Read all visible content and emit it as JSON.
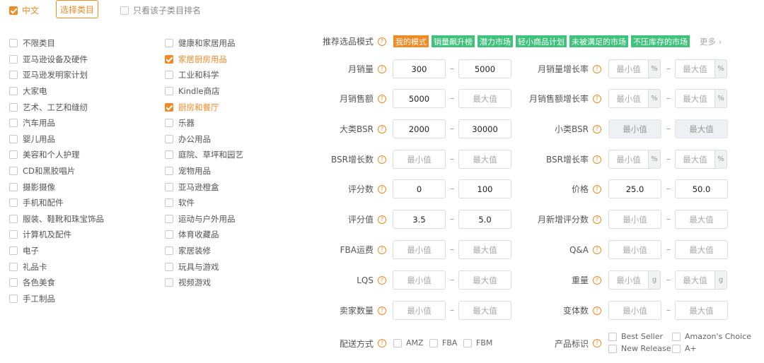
{
  "top": {
    "lang_label": "中文",
    "select_category_button": "选择类目",
    "only_subcategory_label": "只看该子类目排名"
  },
  "categories_left": [
    {
      "label": "不限类目",
      "checked": false
    },
    {
      "label": "亚马逊设备及硬件",
      "checked": false
    },
    {
      "label": "亚马逊发明家计划",
      "checked": false
    },
    {
      "label": "大家电",
      "checked": false
    },
    {
      "label": "艺术、工艺和缝纫",
      "checked": false
    },
    {
      "label": "汽车用品",
      "checked": false
    },
    {
      "label": "婴儿用品",
      "checked": false
    },
    {
      "label": "美容和个人护理",
      "checked": false
    },
    {
      "label": "CD和黑胶唱片",
      "checked": false
    },
    {
      "label": "摄影摄像",
      "checked": false
    },
    {
      "label": "手机和配件",
      "checked": false
    },
    {
      "label": "服装、鞋靴和珠宝饰品",
      "checked": false
    },
    {
      "label": "计算机及配件",
      "checked": false
    },
    {
      "label": "电子",
      "checked": false
    },
    {
      "label": "礼品卡",
      "checked": false
    },
    {
      "label": "各色美食",
      "checked": false
    },
    {
      "label": "手工制品",
      "checked": false
    }
  ],
  "categories_right": [
    {
      "label": "健康和家居用品",
      "checked": false
    },
    {
      "label": "家居厨房用品",
      "checked": true
    },
    {
      "label": "工业和科学",
      "checked": false
    },
    {
      "label": "Kindle商店",
      "checked": false
    },
    {
      "label": "厨房和餐厅",
      "checked": true
    },
    {
      "label": "乐器",
      "checked": false
    },
    {
      "label": "办公用品",
      "checked": false
    },
    {
      "label": "庭院、草坪和园艺",
      "checked": false
    },
    {
      "label": "宠物用品",
      "checked": false
    },
    {
      "label": "亚马逊橙盒",
      "checked": false
    },
    {
      "label": "软件",
      "checked": false
    },
    {
      "label": "运动与户外用品",
      "checked": false
    },
    {
      "label": "体育收藏品",
      "checked": false
    },
    {
      "label": "家居装修",
      "checked": false
    },
    {
      "label": "玩具与游戏",
      "checked": false
    },
    {
      "label": "视频游戏",
      "checked": false
    }
  ],
  "mode": {
    "label": "推荐选品模式",
    "tags": [
      "我的模式",
      "销量飙升榜",
      "潜力市场",
      "轻小商品计划",
      "未被满足的市场",
      "不压库存的市场"
    ],
    "more": "更多 ›"
  },
  "filters": {
    "monthly_sales": {
      "label": "月销量",
      "min": "300",
      "max": "5000"
    },
    "monthly_sales_growth": {
      "label": "月销量增长率",
      "min": "最小值",
      "max": "最大值",
      "unit": "%"
    },
    "monthly_revenue": {
      "label": "月销售额",
      "min": "5000",
      "max": "最大值"
    },
    "monthly_revenue_growth": {
      "label": "月销售额增长率",
      "min": "最小值",
      "max": "最大值",
      "unit": "%"
    },
    "main_bsr": {
      "label": "大类BSR",
      "min": "2000",
      "max": "30000"
    },
    "sub_bsr": {
      "label": "小类BSR",
      "min": "最小值",
      "max": "最大值"
    },
    "bsr_growth_count": {
      "label": "BSR增长数",
      "min": "最小值",
      "max": "最大值"
    },
    "bsr_growth_rate": {
      "label": "BSR增长率",
      "min": "最小值",
      "max": "最大值",
      "unit": "%"
    },
    "review_count": {
      "label": "评分数",
      "min": "0",
      "max": "100"
    },
    "price": {
      "label": "价格",
      "min": "25.0",
      "max": "50.0"
    },
    "rating": {
      "label": "评分值",
      "min": "3.5",
      "max": "5.0"
    },
    "monthly_new_reviews": {
      "label": "月新增评分数",
      "min": "最小值",
      "max": "最大值"
    },
    "fba_fee": {
      "label": "FBA运费",
      "min": "最小值",
      "max": "最大值"
    },
    "qa": {
      "label": "Q&A",
      "min": "最小值",
      "max": "最大值"
    },
    "lqs": {
      "label": "LQS",
      "min": "最小值",
      "max": "最大值"
    },
    "weight": {
      "label": "重量",
      "min": "最小值",
      "max": "最大值",
      "unit": "g"
    },
    "seller_count": {
      "label": "卖家数量",
      "min": "最小值",
      "max": "最大值"
    },
    "variant_count": {
      "label": "变体数",
      "min": "最小值",
      "max": "最大值"
    }
  },
  "shipping": {
    "label": "配送方式",
    "options": [
      "AMZ",
      "FBA",
      "FBM"
    ]
  },
  "product_badge": {
    "label": "产品标识",
    "options": [
      "Best Seller",
      "Amazon's Choice",
      "New Release",
      "A+"
    ]
  },
  "dash": "–"
}
